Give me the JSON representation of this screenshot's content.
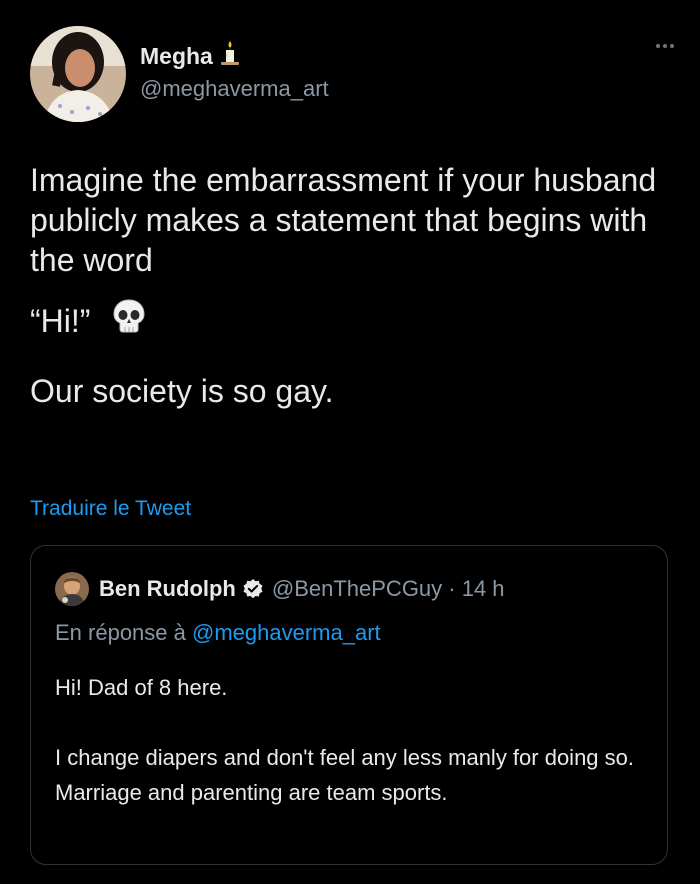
{
  "author": {
    "display_name": "Megha",
    "handle": "@meghaverma_art"
  },
  "tweet": {
    "line1": "Imagine the embarrassment if your husband publicly makes a statement that begins with the word",
    "quote_word": "“Hi!”",
    "line3": "Our society is so gay."
  },
  "translate_label": "Traduire le Tweet",
  "quoted": {
    "display_name": "Ben Rudolph",
    "handle_time": "@BenThePCGuy · 14 h",
    "reply_prefix": "En réponse à",
    "reply_mention": "@meghaverma_art",
    "text_line1": "Hi! Dad of 8 here.",
    "text_line2": "I change diapers and don't feel any less manly for doing so. Marriage and parenting are team sports."
  },
  "colors": {
    "background": "#000000",
    "text": "#e7e9ea",
    "secondary": "#8b98a5",
    "link": "#1d9bf0",
    "border": "#2f3336"
  },
  "icons": [
    "candle-icon",
    "more-icon",
    "skull-icon",
    "verified-badge-icon"
  ]
}
